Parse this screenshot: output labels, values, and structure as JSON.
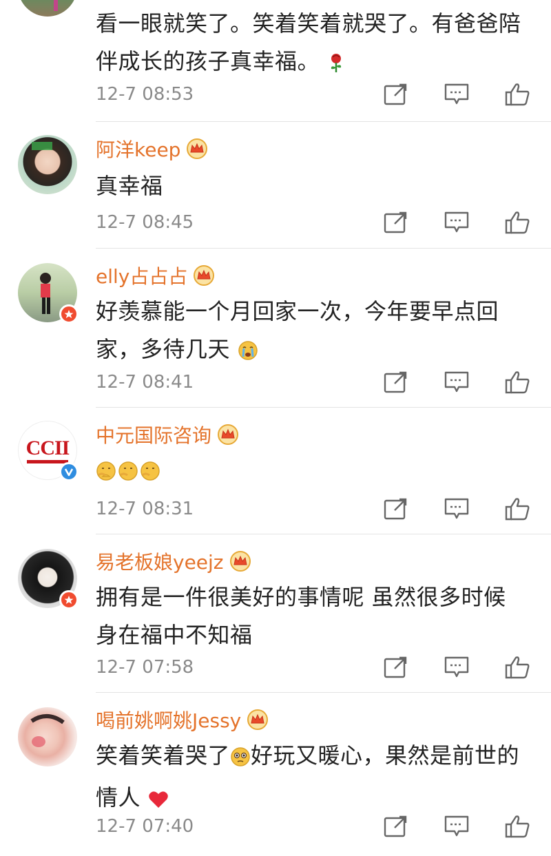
{
  "colors": {
    "username": "#e4732b",
    "timestamp": "#8a8a8a",
    "text": "#222222",
    "divider": "#e3e3e3",
    "badge_red": "#f04b2f",
    "badge_blue": "#2f8de0"
  },
  "comments": [
    {
      "username": "",
      "text_lines": [
        "看一眼就笑了。笑着笑着就哭了。有爸爸陪",
        "伴成长的孩子真幸福。"
      ],
      "emoji": "rose-icon",
      "time": "12-7 08:53"
    },
    {
      "username": "阿洋keep",
      "text_lines": [
        "真幸福"
      ],
      "time": "12-7 08:45"
    },
    {
      "username": "elly占占占",
      "text_lines": [
        "好羡慕能一个月回家一次，今年要早点回",
        "家，多待几天"
      ],
      "emoji": "crying-face-icon",
      "time": "12-7 08:41"
    },
    {
      "username": "中元国际咨询",
      "avatar_text": "CCII",
      "text_lines": [
        ""
      ],
      "emoji": "thinking-face-icon",
      "time": "12-7 08:31"
    },
    {
      "username": "易老板娘yeejz",
      "text_lines": [
        "拥有是一件很美好的事情呢 虽然很多时候",
        "身在福中不知福"
      ],
      "time": "12-7 07:58"
    },
    {
      "username": "喝前姚啊姚Jessy",
      "text_lines": [
        "笑着笑着哭了",
        "好玩又暖心，果然是前世的",
        "情人"
      ],
      "emoji": "pleading-face-icon",
      "emoji2": "heart-icon",
      "time": "12-7 07:40"
    }
  ],
  "actions": {
    "share": "share-icon",
    "comment": "comment-icon",
    "like": "like-icon"
  }
}
